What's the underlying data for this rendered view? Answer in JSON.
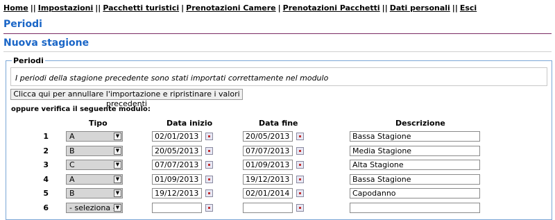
{
  "nav": {
    "items": [
      "Home",
      "Impostazioni",
      "Pacchetti turistici",
      "Prenotazioni Camere",
      "Prenotazioni Pacchetti",
      "Dati personali",
      "Esci"
    ],
    "separator": "||"
  },
  "page_title": "Periodi",
  "section_title": "Nuova stagione",
  "fieldset_legend": "Periodi",
  "info_message": "I periodi della stagione precedente sono stati importati correttamente nel modulo",
  "undo_button_label": "Clicca qui per annullare l'importazione e ripristinare i valori precedenti",
  "verify_label": "oppure verifica il seguente modulo:",
  "table": {
    "headers": {
      "tipo": "Tipo",
      "data_inizio": "Data inizio",
      "data_fine": "Data fine",
      "descrizione": "Descrizione"
    },
    "rows": [
      {
        "num": "1",
        "tipo": "A",
        "data_inizio": "02/01/2013",
        "data_fine": "20/05/2013",
        "descrizione": "Bassa Stagione"
      },
      {
        "num": "2",
        "tipo": "B",
        "data_inizio": "20/05/2013",
        "data_fine": "07/07/2013",
        "descrizione": "Media Stagione"
      },
      {
        "num": "3",
        "tipo": "C",
        "data_inizio": "07/07/2013",
        "data_fine": "01/09/2013",
        "descrizione": "Alta Stagione"
      },
      {
        "num": "4",
        "tipo": "A",
        "data_inizio": "01/09/2013",
        "data_fine": "19/12/2013",
        "descrizione": "Bassa Stagione"
      },
      {
        "num": "5",
        "tipo": "B",
        "data_inizio": "19/12/2013",
        "data_fine": "02/01/2014",
        "descrizione": "Capodanno"
      },
      {
        "num": "6",
        "tipo": "- seleziona -",
        "data_inizio": "",
        "data_fine": "",
        "descrizione": ""
      }
    ]
  },
  "icons": {
    "select_arrow": "chevron-down-icon",
    "calendar": "calendar-icon"
  },
  "colors": {
    "title": "#1a66c7",
    "title_rule": "#7a2a63",
    "fieldset_border": "#7aa6d6"
  }
}
